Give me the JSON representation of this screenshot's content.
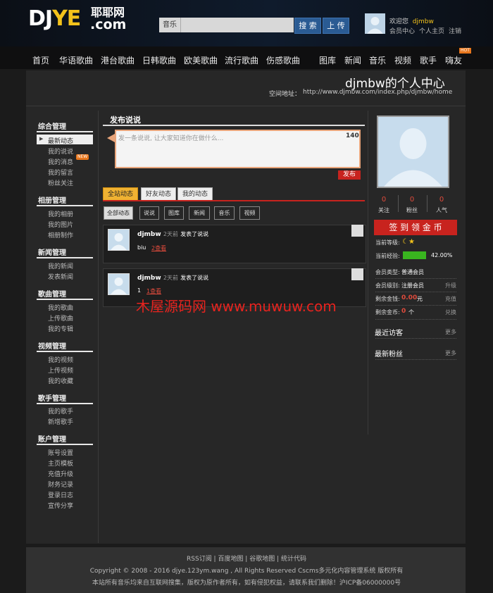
{
  "header": {
    "logo_main": "DJ",
    "logo_ye": "YE",
    "logo_cn": "耶耶网",
    "logo_dotcom": ".com",
    "search_category": "音乐",
    "search_placeholder": "",
    "search_button": "搜 索",
    "upload_button": "上 传",
    "welcome_prefix": "欢迎您",
    "username": "djmbw",
    "user_links": [
      "会员中心",
      "个人主页",
      "注销"
    ]
  },
  "nav": {
    "left": [
      "首页",
      "华语歌曲",
      "港台歌曲",
      "日韩歌曲",
      "欧美歌曲",
      "流行歌曲",
      "伤感歌曲"
    ],
    "right": [
      "图库",
      "新闻",
      "音乐",
      "视频",
      "歌手",
      "嗨友"
    ],
    "hot_badge": "HOT"
  },
  "center": {
    "title": "djmbw的个人中心",
    "space_label": "空间地址：",
    "space_url": "http://www.djmbw.com/index.php/djmbw/home"
  },
  "sidebar": {
    "sections": [
      {
        "title": "综合管理",
        "items": [
          "最新动态",
          "我的说说",
          "我的消息",
          "我的留言",
          "粉丝关注"
        ]
      },
      {
        "title": "相册管理",
        "items": [
          "我的相册",
          "我的图片",
          "相册制作"
        ]
      },
      {
        "title": "新闻管理",
        "items": [
          "我的新闻",
          "发表新闻"
        ]
      },
      {
        "title": "歌曲管理",
        "items": [
          "我的歌曲",
          "上传歌曲",
          "我的专辑"
        ]
      },
      {
        "title": "视频管理",
        "items": [
          "我的视频",
          "上传视频",
          "我的收藏"
        ]
      },
      {
        "title": "歌手管理",
        "items": [
          "我的歌手",
          "新增歌手"
        ]
      },
      {
        "title": "账户管理",
        "items": [
          "账号设置",
          "主页模板",
          "充值升级",
          "财务记录",
          "登录日志",
          "宣传分享"
        ]
      }
    ],
    "message_badge": "NEW"
  },
  "post": {
    "title": "发布说说",
    "placeholder": "发一条说说, 让大家知道你在做什么...",
    "char_count": "140",
    "publish_button": "发布"
  },
  "tabs": [
    "全站动态",
    "好友动态",
    "我的动态"
  ],
  "filters": [
    "全部动态",
    "说说",
    "图库",
    "新闻",
    "音乐",
    "视频"
  ],
  "feed": [
    {
      "user": "djmbw",
      "time": "2天前",
      "action": "发表了说说",
      "body": "biu",
      "reply": "2查看"
    },
    {
      "user": "djmbw",
      "time": "2天前",
      "action": "发表了说说",
      "body": "1",
      "reply": "1查看"
    }
  ],
  "watermark": "木屋源码网 www.muwuw.com",
  "profile": {
    "stats": [
      {
        "value": "0",
        "label": "关注"
      },
      {
        "value": "0",
        "label": "粉丝"
      },
      {
        "value": "0",
        "label": "人气"
      }
    ],
    "checkin_button": "签 到 领 金 币",
    "level_label": "当前等级:",
    "exp_label": "当前经验:",
    "exp_percent": "42.00%",
    "exp_fraction": 0.42,
    "member_type_label": "会员类型:",
    "member_type": "普通会员",
    "member_level_label": "会员级别:",
    "member_level": "注册会员",
    "upgrade": "升级",
    "money_label": "剩余金钱:",
    "money_value": "0.00",
    "money_unit": "元",
    "recharge": "充值",
    "coins_label": "剩余金币:",
    "coins_value": "0",
    "coins_unit": "个",
    "exchange": "兑换",
    "recent_visitors": "最近访客",
    "recent_fans": "最新粉丝",
    "more": "更多"
  },
  "footer": {
    "links": "RSS订阅 | 百度地图 | 谷歌地图 | 统计代码",
    "copyright": "Copyright © 2008 - 2016 djye.123ym.wang , All Rights Reserved Cscms多元化内容管理系统 版权所有",
    "notice": "本站所有音乐均来自互联网搜集，版权为原作者所有，如有侵犯权益，请联系我们删除！沪ICP备06000000号"
  },
  "colors": {
    "accent_red": "#c8231e",
    "logo_yellow": "#f3c21b",
    "exp_green": "#39b51f",
    "button_blue": "#2a5b93"
  }
}
